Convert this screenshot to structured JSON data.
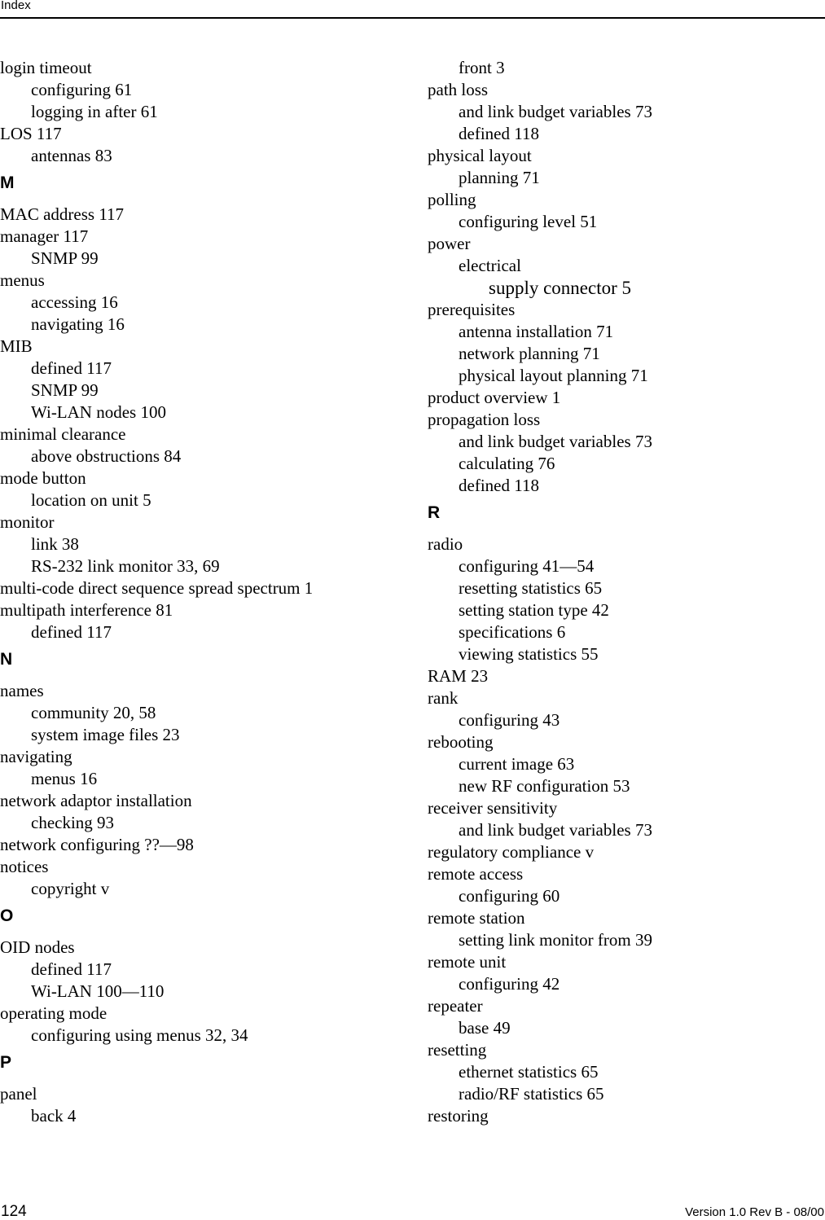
{
  "header": {
    "title": "Index"
  },
  "footer": {
    "page_number": "124",
    "version": "Version 1.0 Rev B - 08/00"
  },
  "columns": [
    {
      "entries": [
        {
          "type": "entry",
          "level": 1,
          "text": "login timeout"
        },
        {
          "type": "entry",
          "level": 2,
          "text": "configuring 61"
        },
        {
          "type": "entry",
          "level": 2,
          "text": "logging in after 61"
        },
        {
          "type": "entry",
          "level": 1,
          "text": "LOS 117"
        },
        {
          "type": "entry",
          "level": 2,
          "text": "antennas 83"
        },
        {
          "type": "letter",
          "text": "M"
        },
        {
          "type": "entry",
          "level": 1,
          "text": "MAC address 117"
        },
        {
          "type": "entry",
          "level": 1,
          "text": "manager 117"
        },
        {
          "type": "entry",
          "level": 2,
          "text": "SNMP 99"
        },
        {
          "type": "entry",
          "level": 1,
          "text": "menus"
        },
        {
          "type": "entry",
          "level": 2,
          "text": "accessing 16"
        },
        {
          "type": "entry",
          "level": 2,
          "text": "navigating 16"
        },
        {
          "type": "entry",
          "level": 1,
          "text": "MIB"
        },
        {
          "type": "entry",
          "level": 2,
          "text": "defined 117"
        },
        {
          "type": "entry",
          "level": 2,
          "text": "SNMP 99"
        },
        {
          "type": "entry",
          "level": 2,
          "text": "Wi-LAN nodes 100"
        },
        {
          "type": "entry",
          "level": 1,
          "text": "minimal clearance"
        },
        {
          "type": "entry",
          "level": 2,
          "text": "above obstructions 84"
        },
        {
          "type": "entry",
          "level": 1,
          "text": "mode button"
        },
        {
          "type": "entry",
          "level": 2,
          "text": "location on unit 5"
        },
        {
          "type": "entry",
          "level": 1,
          "text": "monitor"
        },
        {
          "type": "entry",
          "level": 2,
          "text": "link 38"
        },
        {
          "type": "entry",
          "level": 2,
          "text": "RS-232 link monitor 33, 69"
        },
        {
          "type": "entry",
          "level": 1,
          "text": "multi-code direct sequence spread spectrum 1"
        },
        {
          "type": "entry",
          "level": 1,
          "text": "multipath interference 81"
        },
        {
          "type": "entry",
          "level": 2,
          "text": "defined 117"
        },
        {
          "type": "letter",
          "text": "N"
        },
        {
          "type": "entry",
          "level": 1,
          "text": "names"
        },
        {
          "type": "entry",
          "level": 2,
          "text": "community 20, 58"
        },
        {
          "type": "entry",
          "level": 2,
          "text": "system image files 23"
        },
        {
          "type": "entry",
          "level": 1,
          "text": "navigating"
        },
        {
          "type": "entry",
          "level": 2,
          "text": "menus 16"
        },
        {
          "type": "entry",
          "level": 1,
          "text": "network adaptor installation"
        },
        {
          "type": "entry",
          "level": 2,
          "text": "checking 93"
        },
        {
          "type": "entry",
          "level": 1,
          "text": "network configuring ??—98"
        },
        {
          "type": "entry",
          "level": 1,
          "text": "notices"
        },
        {
          "type": "entry",
          "level": 2,
          "text": "copyright v"
        },
        {
          "type": "letter",
          "text": "O"
        },
        {
          "type": "entry",
          "level": 1,
          "text": "OID nodes"
        },
        {
          "type": "entry",
          "level": 2,
          "text": "defined 117"
        },
        {
          "type": "entry",
          "level": 2,
          "text": "Wi-LAN 100—110"
        },
        {
          "type": "entry",
          "level": 1,
          "text": "operating mode"
        },
        {
          "type": "entry",
          "level": 2,
          "text": "configuring using menus 32, 34"
        },
        {
          "type": "letter",
          "text": "P"
        },
        {
          "type": "entry",
          "level": 1,
          "text": "panel"
        },
        {
          "type": "entry",
          "level": 2,
          "text": "back 4"
        }
      ]
    },
    {
      "entries": [
        {
          "type": "entry",
          "level": 2,
          "text": "front 3"
        },
        {
          "type": "entry",
          "level": 1,
          "text": "path loss"
        },
        {
          "type": "entry",
          "level": 2,
          "text": "and link budget variables 73"
        },
        {
          "type": "entry",
          "level": 2,
          "text": "defined 118"
        },
        {
          "type": "entry",
          "level": 1,
          "text": "physical layout"
        },
        {
          "type": "entry",
          "level": 2,
          "text": "planning 71"
        },
        {
          "type": "entry",
          "level": 1,
          "text": "polling"
        },
        {
          "type": "entry",
          "level": 2,
          "text": "configuring level 51"
        },
        {
          "type": "entry",
          "level": 1,
          "text": "power"
        },
        {
          "type": "entry",
          "level": 2,
          "text": "electrical"
        },
        {
          "type": "entry",
          "level": 3,
          "text": "supply connector 5"
        },
        {
          "type": "entry",
          "level": 1,
          "text": "prerequisites"
        },
        {
          "type": "entry",
          "level": 2,
          "text": "antenna installation 71"
        },
        {
          "type": "entry",
          "level": 2,
          "text": "network planning 71"
        },
        {
          "type": "entry",
          "level": 2,
          "text": "physical layout planning 71"
        },
        {
          "type": "entry",
          "level": 1,
          "text": "product overview 1"
        },
        {
          "type": "entry",
          "level": 1,
          "text": "propagation loss"
        },
        {
          "type": "entry",
          "level": 2,
          "text": "and link budget variables 73"
        },
        {
          "type": "entry",
          "level": 2,
          "text": "calculating 76"
        },
        {
          "type": "entry",
          "level": 2,
          "text": "defined 118"
        },
        {
          "type": "letter",
          "text": "R"
        },
        {
          "type": "entry",
          "level": 1,
          "text": "radio"
        },
        {
          "type": "entry",
          "level": 2,
          "text": "configuring 41—54"
        },
        {
          "type": "entry",
          "level": 2,
          "text": "resetting statistics 65"
        },
        {
          "type": "entry",
          "level": 2,
          "text": "setting station type 42"
        },
        {
          "type": "entry",
          "level": 2,
          "text": "specifications 6"
        },
        {
          "type": "entry",
          "level": 2,
          "text": "viewing statistics 55"
        },
        {
          "type": "entry",
          "level": 1,
          "text": "RAM 23"
        },
        {
          "type": "entry",
          "level": 1,
          "text": "rank"
        },
        {
          "type": "entry",
          "level": 2,
          "text": "configuring 43"
        },
        {
          "type": "entry",
          "level": 1,
          "text": "rebooting"
        },
        {
          "type": "entry",
          "level": 2,
          "text": "current image 63"
        },
        {
          "type": "entry",
          "level": 2,
          "text": "new RF configuration 53"
        },
        {
          "type": "entry",
          "level": 1,
          "text": "receiver sensitivity"
        },
        {
          "type": "entry",
          "level": 2,
          "text": "and link budget variables 73"
        },
        {
          "type": "entry",
          "level": 1,
          "text": "regulatory compliance v"
        },
        {
          "type": "entry",
          "level": 1,
          "text": "remote access"
        },
        {
          "type": "entry",
          "level": 2,
          "text": "configuring 60"
        },
        {
          "type": "entry",
          "level": 1,
          "text": "remote station"
        },
        {
          "type": "entry",
          "level": 2,
          "text": "setting link monitor from 39"
        },
        {
          "type": "entry",
          "level": 1,
          "text": "remote unit"
        },
        {
          "type": "entry",
          "level": 2,
          "text": "configuring 42"
        },
        {
          "type": "entry",
          "level": 1,
          "text": "repeater"
        },
        {
          "type": "entry",
          "level": 2,
          "text": "base 49"
        },
        {
          "type": "entry",
          "level": 1,
          "text": "resetting"
        },
        {
          "type": "entry",
          "level": 2,
          "text": "ethernet statistics 65"
        },
        {
          "type": "entry",
          "level": 2,
          "text": "radio/RF statistics 65"
        },
        {
          "type": "entry",
          "level": 1,
          "text": "restoring"
        }
      ]
    }
  ]
}
